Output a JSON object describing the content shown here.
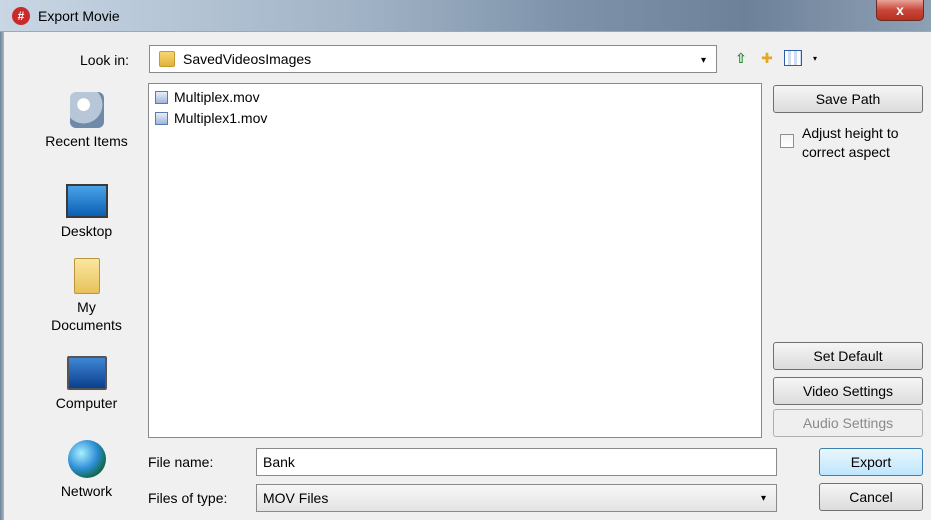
{
  "window": {
    "title": "Export Movie",
    "app_icon_glyph": "#",
    "close_glyph": "x"
  },
  "lookin": {
    "label": "Look in:",
    "value": "SavedVideosImages",
    "arrow": "▾"
  },
  "toolbar": {
    "up_icon": "up-one-level-icon",
    "up_glyph": "⇧",
    "new_folder_icon": "create-new-folder-icon",
    "new_folder_glyph": "✚",
    "view_caret": "▾"
  },
  "places": [
    {
      "label": "Recent Items",
      "icon": "recent-items-icon"
    },
    {
      "label": "Desktop",
      "icon": "desktop-icon"
    },
    {
      "label": "My\nDocuments",
      "icon": "my-documents-icon"
    },
    {
      "label": "Computer",
      "icon": "computer-icon"
    },
    {
      "label": "Network",
      "icon": "network-icon"
    }
  ],
  "files": [
    {
      "name": "Multiplex.mov"
    },
    {
      "name": "Multiplex1.mov"
    }
  ],
  "buttons": {
    "save_path": "Save Path",
    "set_default": "Set Default",
    "video_settings": "Video Settings",
    "audio_settings": "Audio Settings",
    "export": "Export",
    "cancel": "Cancel"
  },
  "adjust_height": {
    "label": "Adjust height to correct aspect",
    "checked": false
  },
  "file_name": {
    "label": "File name:",
    "value": "Bank"
  },
  "file_type": {
    "label": "Files of type:",
    "value": "MOV Files",
    "arrow": "▾"
  }
}
